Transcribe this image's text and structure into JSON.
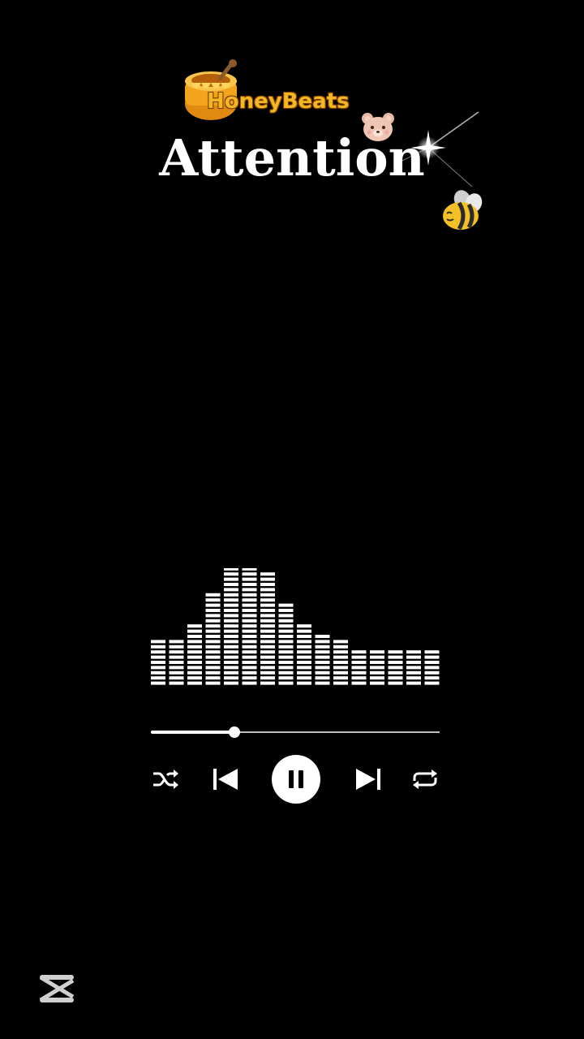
{
  "header": {
    "brand_text": "HoneyBeats",
    "song_title": "Attention"
  },
  "player": {
    "progress_fraction": 0.29,
    "controls": [
      {
        "name": "shuffle",
        "icon": "shuffle-icon"
      },
      {
        "name": "previous",
        "icon": "skip-previous-icon"
      },
      {
        "name": "pause",
        "icon": "pause-icon"
      },
      {
        "name": "next",
        "icon": "skip-next-icon"
      },
      {
        "name": "repeat",
        "icon": "repeat-icon"
      }
    ],
    "equalizer_levels": [
      0.33,
      0.33,
      0.47,
      0.7,
      0.93,
      1.0,
      0.85,
      0.63,
      0.47,
      0.37,
      0.33,
      0.27,
      0.27,
      0.27,
      0.27,
      0.27
    ]
  },
  "colors": {
    "background": "#000000",
    "brand": "#f4b623",
    "foreground": "#ffffff"
  },
  "watermark": {
    "icon": "capcut-logo-icon"
  }
}
